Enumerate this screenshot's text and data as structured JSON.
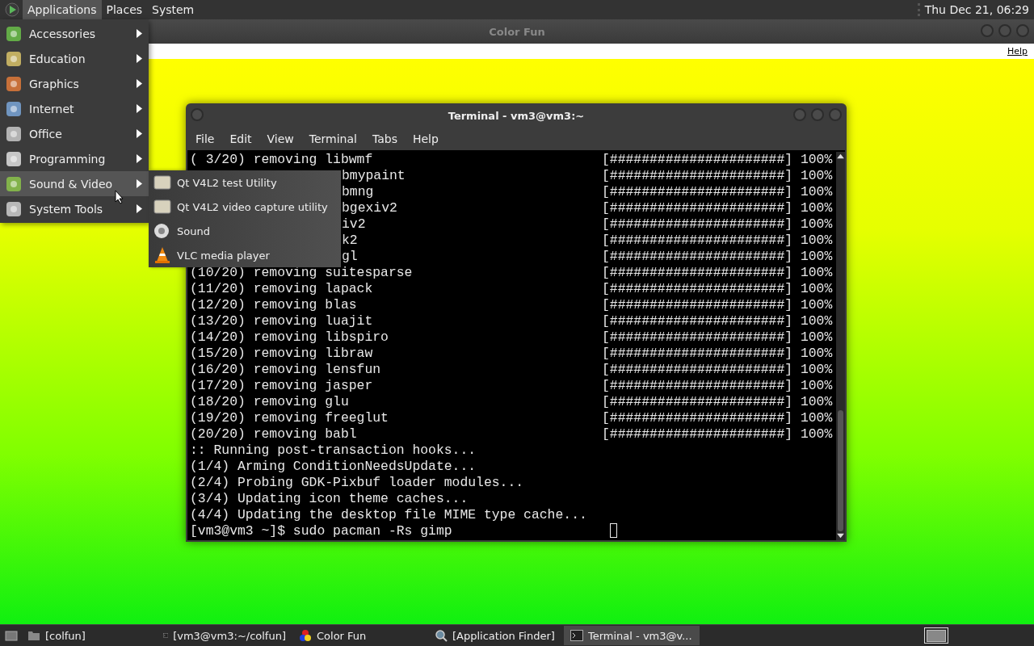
{
  "top_panel": {
    "menus": [
      {
        "label": "Applications",
        "selected": true
      },
      {
        "label": "Places",
        "selected": false
      },
      {
        "label": "System",
        "selected": false
      }
    ],
    "clock": "Thu Dec 21, 06:29"
  },
  "background_window": {
    "title": "Color Fun",
    "menu": [
      "Help"
    ]
  },
  "applications_menu": {
    "items": [
      {
        "label": "Accessories",
        "selected": false
      },
      {
        "label": "Education",
        "selected": false
      },
      {
        "label": "Graphics",
        "selected": false
      },
      {
        "label": "Internet",
        "selected": false
      },
      {
        "label": "Office",
        "selected": false
      },
      {
        "label": "Programming",
        "selected": false
      },
      {
        "label": "Sound & Video",
        "selected": true
      },
      {
        "label": "System Tools",
        "selected": false
      }
    ],
    "submenu": [
      {
        "label": "Qt V4L2 test Utility",
        "kind": "generic"
      },
      {
        "label": "Qt V4L2 video capture utility",
        "kind": "generic"
      },
      {
        "label": "Sound",
        "kind": "sound"
      },
      {
        "label": "VLC media player",
        "kind": "vlc"
      }
    ]
  },
  "terminal": {
    "title": "Terminal - vm3@vm3:~",
    "menu": [
      "File",
      "Edit",
      "View",
      "Terminal",
      "Tabs",
      "Help"
    ],
    "lines": [
      {
        "kind": "progress",
        "text": "( 3/20) removing libwmf",
        "progress": "[######################] 100%"
      },
      {
        "kind": "partial",
        "text": "bmypaint",
        "progress": "[######################] 100%"
      },
      {
        "kind": "partial",
        "text": "bmng",
        "progress": "[######################] 100%"
      },
      {
        "kind": "partial",
        "text": "bgexiv2",
        "progress": "[######################] 100%"
      },
      {
        "kind": "partial",
        "text": "iv2",
        "progress": "[######################] 100%"
      },
      {
        "kind": "partial",
        "text": "k2",
        "progress": "[######################] 100%"
      },
      {
        "kind": "partial",
        "text": "gl",
        "progress": "[######################] 100%"
      },
      {
        "kind": "progress",
        "text": "(10/20) removing suitesparse",
        "progress": "[######################] 100%"
      },
      {
        "kind": "progress",
        "text": "(11/20) removing lapack",
        "progress": "[######################] 100%"
      },
      {
        "kind": "progress",
        "text": "(12/20) removing blas",
        "progress": "[######################] 100%"
      },
      {
        "kind": "progress",
        "text": "(13/20) removing luajit",
        "progress": "[######################] 100%"
      },
      {
        "kind": "progress",
        "text": "(14/20) removing libspiro",
        "progress": "[######################] 100%"
      },
      {
        "kind": "progress",
        "text": "(15/20) removing libraw",
        "progress": "[######################] 100%"
      },
      {
        "kind": "progress",
        "text": "(16/20) removing lensfun",
        "progress": "[######################] 100%"
      },
      {
        "kind": "progress",
        "text": "(17/20) removing jasper",
        "progress": "[######################] 100%"
      },
      {
        "kind": "progress",
        "text": "(18/20) removing glu",
        "progress": "[######################] 100%"
      },
      {
        "kind": "progress",
        "text": "(19/20) removing freeglut",
        "progress": "[######################] 100%"
      },
      {
        "kind": "progress",
        "text": "(20/20) removing babl",
        "progress": "[######################] 100%"
      },
      {
        "kind": "plain",
        "text": ":: Running post-transaction hooks..."
      },
      {
        "kind": "plain",
        "text": "(1/4) Arming ConditionNeedsUpdate..."
      },
      {
        "kind": "plain",
        "text": "(2/4) Probing GDK-Pixbuf loader modules..."
      },
      {
        "kind": "plain",
        "text": "(3/4) Updating icon theme caches..."
      },
      {
        "kind": "plain",
        "text": "(4/4) Updating the desktop file MIME type cache..."
      },
      {
        "kind": "prompt",
        "text": "[vm3@vm3 ~]$ sudo pacman -Rs gimp"
      }
    ]
  },
  "taskbar": {
    "items": [
      {
        "label": "[colfun]",
        "kind": "folder",
        "selected": false
      },
      {
        "label": "[vm3@vm3:~/colfun]",
        "kind": "terminal",
        "selected": false
      },
      {
        "label": "Color Fun",
        "kind": "colors",
        "selected": false
      },
      {
        "label": "[Application Finder]",
        "kind": "finder",
        "selected": false
      },
      {
        "label": "Terminal - vm3@v...",
        "kind": "terminal",
        "selected": true
      }
    ]
  }
}
